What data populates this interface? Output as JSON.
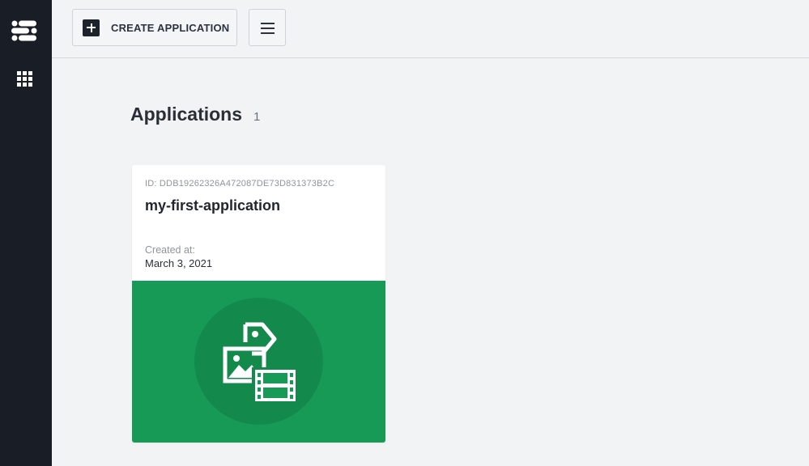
{
  "toolbar": {
    "create_label": "CREATE APPLICATION"
  },
  "main": {
    "title": "Applications",
    "count": "1"
  },
  "applications": [
    {
      "id_label": "ID: DDB19262326A472087DE73D831373B2C",
      "name": "my-first-application",
      "created_label": "Created at:",
      "created_date": "March 3, 2021"
    }
  ],
  "icons": {
    "logo": "brand-logo-icon",
    "apps": "apps-grid-icon",
    "plus": "plus-icon",
    "menu": "hamburger-menu-icon",
    "media": "media-tag-icon"
  },
  "colors": {
    "sidebar": "#181d26",
    "background": "#f2f3f5",
    "banner": "#189a57",
    "banner_circle": "#138a4c"
  }
}
